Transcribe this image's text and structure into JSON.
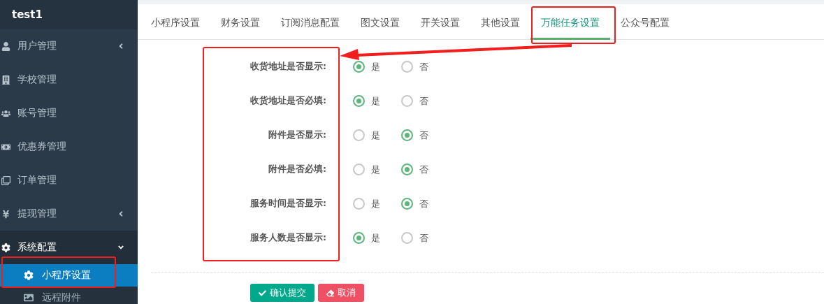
{
  "brand": "test1",
  "sidebar": {
    "items": [
      {
        "label": "用户管理",
        "expanded": false
      },
      {
        "label": "学校管理"
      },
      {
        "label": "账号管理"
      },
      {
        "label": "优惠券管理"
      },
      {
        "label": "订单管理"
      },
      {
        "label": "提现管理",
        "expanded": false
      },
      {
        "label": "系统配置",
        "expanded": true,
        "children": [
          {
            "label": "小程序设置",
            "selected": true
          },
          {
            "label": "远程附件",
            "selected": false
          }
        ]
      }
    ]
  },
  "tabs": [
    {
      "label": "小程序设置",
      "selected": false
    },
    {
      "label": "财务设置",
      "selected": false
    },
    {
      "label": "订阅消息配置",
      "selected": false
    },
    {
      "label": "图文设置",
      "selected": false
    },
    {
      "label": "开关设置",
      "selected": false
    },
    {
      "label": "其他设置",
      "selected": false
    },
    {
      "label": "万能任务设置",
      "selected": true
    },
    {
      "label": "公众号配置",
      "selected": false
    }
  ],
  "form": {
    "rows": [
      {
        "label": "收货地址是否显示:",
        "options": [
          {
            "label": "是",
            "selected": true
          },
          {
            "label": "否",
            "selected": false
          }
        ]
      },
      {
        "label": "收货地址是否必填:",
        "options": [
          {
            "label": "是",
            "selected": true
          },
          {
            "label": "否",
            "selected": false
          }
        ]
      },
      {
        "label": "附件是否显示:",
        "options": [
          {
            "label": "是",
            "selected": false
          },
          {
            "label": "否",
            "selected": true
          }
        ]
      },
      {
        "label": "附件是否必填:",
        "options": [
          {
            "label": "是",
            "selected": false
          },
          {
            "label": "否",
            "selected": true
          }
        ]
      },
      {
        "label": "服务时间是否显示:",
        "options": [
          {
            "label": "是",
            "selected": false
          },
          {
            "label": "否",
            "selected": true
          }
        ]
      },
      {
        "label": "服务人数是否显示:",
        "options": [
          {
            "label": "是",
            "selected": true
          },
          {
            "label": "否",
            "selected": false
          }
        ]
      }
    ]
  },
  "buttons": [
    {
      "label": "确认提交",
      "kind": "submit"
    },
    {
      "label": "取消",
      "kind": "cancel"
    }
  ]
}
